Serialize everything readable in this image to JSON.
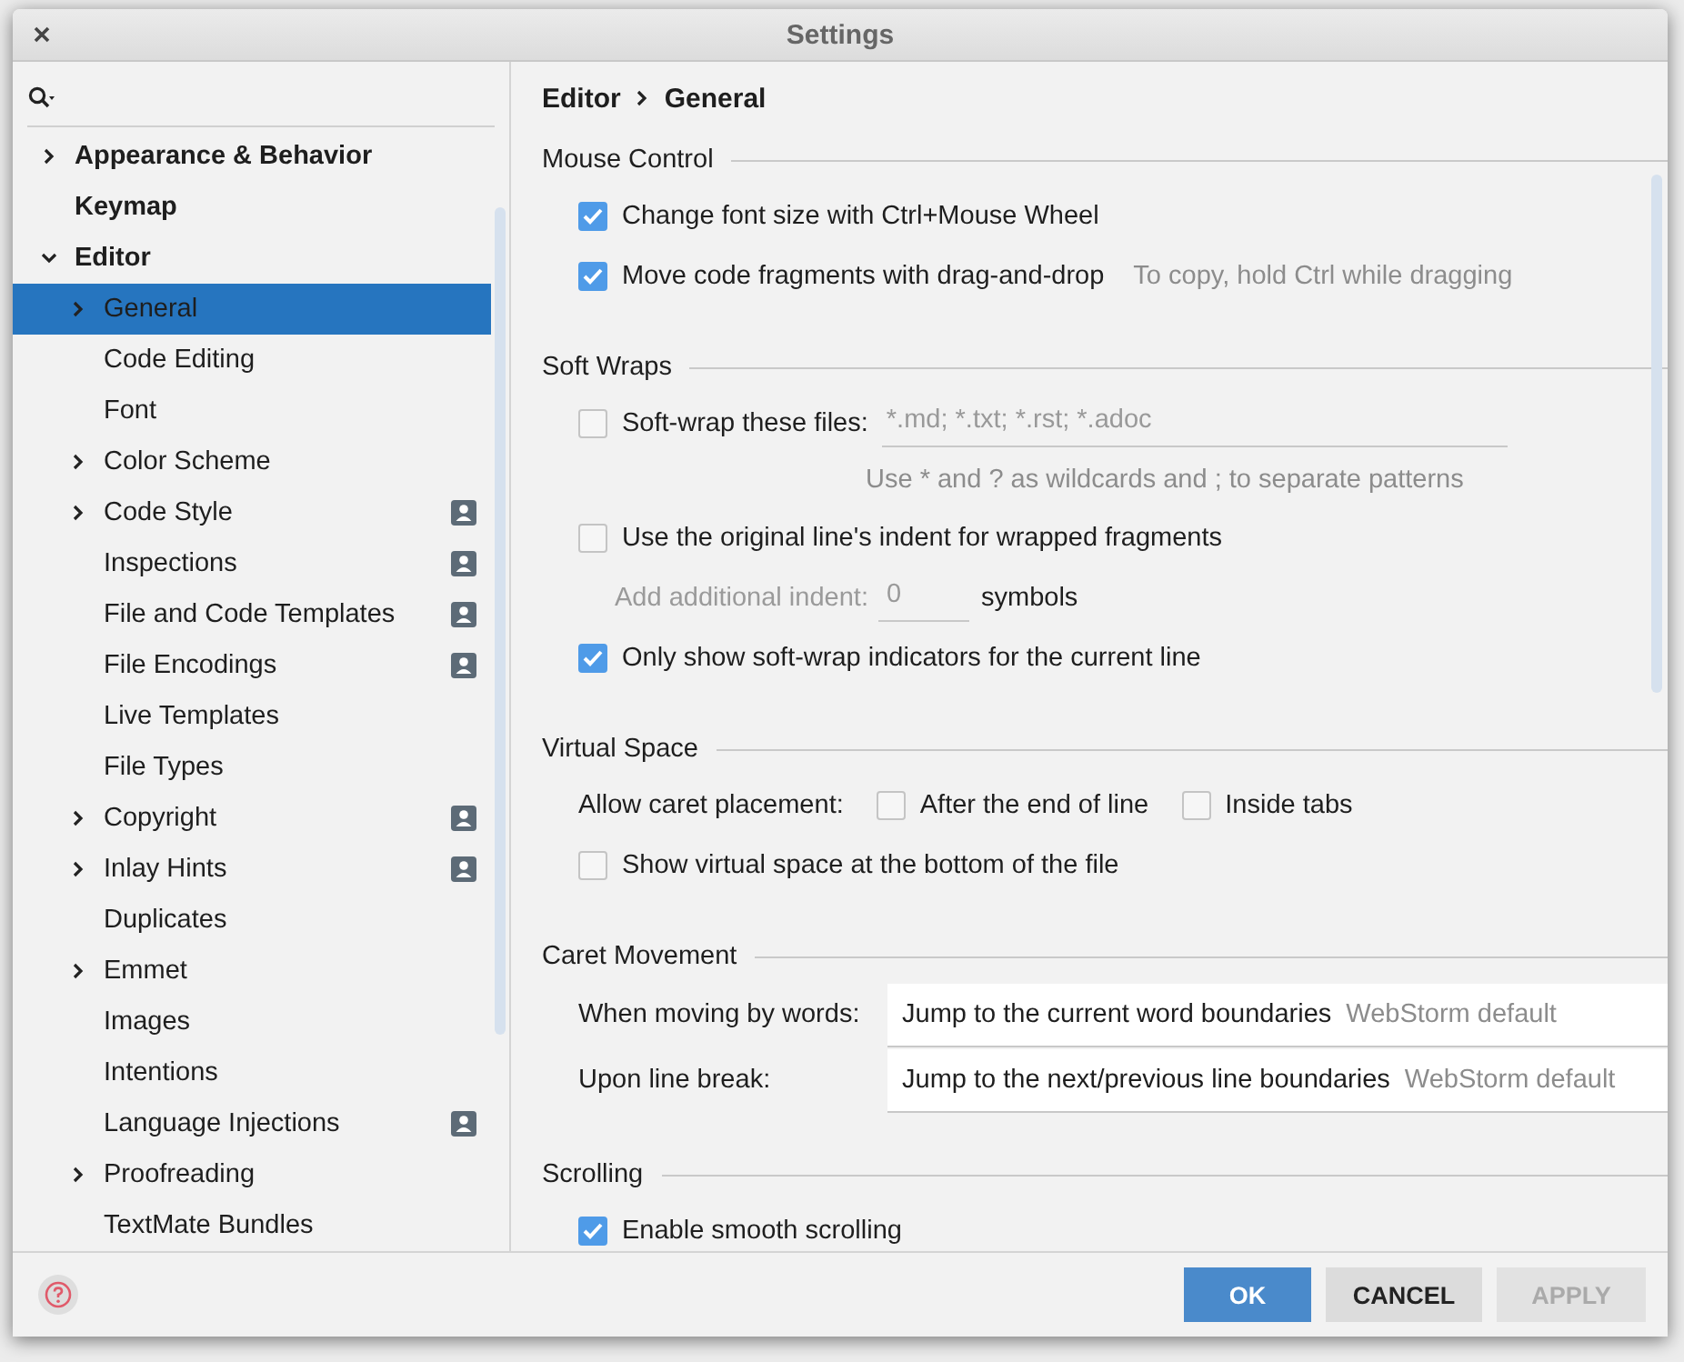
{
  "window": {
    "title": "Settings"
  },
  "sidebar": {
    "items": [
      {
        "label": "Appearance & Behavior",
        "expandable": true,
        "expanded": false,
        "selected": false,
        "project_badge": false
      },
      {
        "label": "Keymap",
        "expandable": false,
        "selected": false,
        "project_badge": false
      },
      {
        "label": "Editor",
        "expandable": true,
        "expanded": true,
        "selected": false,
        "project_badge": false,
        "children": [
          {
            "label": "General",
            "expandable": true,
            "expanded": false,
            "selected": true,
            "project_badge": false
          },
          {
            "label": "Code Editing",
            "expandable": false,
            "selected": false,
            "project_badge": false
          },
          {
            "label": "Font",
            "expandable": false,
            "selected": false,
            "project_badge": false
          },
          {
            "label": "Color Scheme",
            "expandable": true,
            "expanded": false,
            "selected": false,
            "project_badge": false
          },
          {
            "label": "Code Style",
            "expandable": true,
            "expanded": false,
            "selected": false,
            "project_badge": true
          },
          {
            "label": "Inspections",
            "expandable": false,
            "selected": false,
            "project_badge": true
          },
          {
            "label": "File and Code Templates",
            "expandable": false,
            "selected": false,
            "project_badge": true
          },
          {
            "label": "File Encodings",
            "expandable": false,
            "selected": false,
            "project_badge": true
          },
          {
            "label": "Live Templates",
            "expandable": false,
            "selected": false,
            "project_badge": false
          },
          {
            "label": "File Types",
            "expandable": false,
            "selected": false,
            "project_badge": false
          },
          {
            "label": "Copyright",
            "expandable": true,
            "expanded": false,
            "selected": false,
            "project_badge": true
          },
          {
            "label": "Inlay Hints",
            "expandable": true,
            "expanded": false,
            "selected": false,
            "project_badge": true
          },
          {
            "label": "Duplicates",
            "expandable": false,
            "selected": false,
            "project_badge": false
          },
          {
            "label": "Emmet",
            "expandable": true,
            "expanded": false,
            "selected": false,
            "project_badge": false
          },
          {
            "label": "Images",
            "expandable": false,
            "selected": false,
            "project_badge": false
          },
          {
            "label": "Intentions",
            "expandable": false,
            "selected": false,
            "project_badge": false
          },
          {
            "label": "Language Injections",
            "expandable": false,
            "selected": false,
            "project_badge": true
          },
          {
            "label": "Proofreading",
            "expandable": true,
            "expanded": false,
            "selected": false,
            "project_badge": false
          },
          {
            "label": "TextMate Bundles",
            "expandable": false,
            "selected": false,
            "project_badge": false
          }
        ]
      }
    ]
  },
  "breadcrumb": [
    "Editor",
    "General"
  ],
  "sections": [
    {
      "title": "Mouse Control",
      "rows": [
        {
          "kind": "checkbox",
          "label": "Change font size with Ctrl+Mouse Wheel",
          "checked": true
        },
        {
          "kind": "checkbox",
          "label": "Move code fragments with drag-and-drop",
          "checked": true,
          "hint": "To copy, hold Ctrl while dragging"
        }
      ]
    },
    {
      "title": "Soft Wraps",
      "rows": [
        {
          "kind": "checkbox-field",
          "label": "Soft-wrap these files:",
          "checked": false,
          "placeholder": "*.md; *.txt; *.rst; *.adoc",
          "hint": "Use * and ? as wildcards and ; to separate patterns"
        },
        {
          "kind": "checkbox",
          "label": "Use the original line's indent for wrapped fragments",
          "checked": false
        },
        {
          "kind": "number",
          "label": "Add additional indent:",
          "placeholder": "0",
          "unit": "symbols",
          "disabled": true
        },
        {
          "kind": "checkbox",
          "label": "Only show soft-wrap indicators for the current line",
          "checked": true
        }
      ]
    },
    {
      "title": "Virtual Space",
      "rows": [
        {
          "kind": "options",
          "label": "Allow caret placement:",
          "options": [
            {
              "label": "After the end of line",
              "checked": false
            },
            {
              "label": "Inside tabs",
              "checked": false
            }
          ]
        },
        {
          "kind": "checkbox",
          "label": "Show virtual space at the bottom of the file",
          "checked": false
        }
      ]
    },
    {
      "title": "Caret Movement",
      "rows": [
        {
          "kind": "select",
          "label": "When moving by words:",
          "value": "Jump to the current word boundaries",
          "hint": "WebStorm default"
        },
        {
          "kind": "select",
          "label": "Upon line break:",
          "value": "Jump to the next/previous line boundaries",
          "hint": "WebStorm default"
        }
      ]
    },
    {
      "title": "Scrolling",
      "rows": [
        {
          "kind": "checkbox",
          "label": "Enable smooth scrolling",
          "checked": true
        }
      ]
    }
  ],
  "buttons": [
    {
      "label": "OK",
      "kind": "primary",
      "disabled": false
    },
    {
      "label": "CANCEL",
      "kind": "normal",
      "disabled": false
    },
    {
      "label": "APPLY",
      "kind": "normal",
      "disabled": true
    }
  ]
}
